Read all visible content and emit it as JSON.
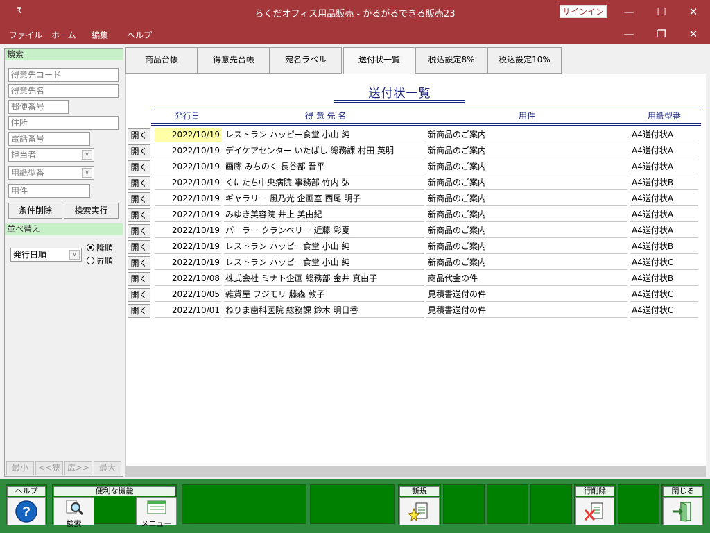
{
  "window": {
    "title": "らくだオフィス用品販売 - かるがるできる販売23",
    "signin": "サインイン",
    "quick_access": "₹"
  },
  "menu": [
    "ファイル",
    "ホーム",
    "編集",
    "ヘルプ"
  ],
  "sidebar": {
    "search_header": "検索",
    "fields": {
      "customer_code": "得意先コード",
      "customer_name": "得意先名",
      "postal": "郵便番号",
      "address": "住所",
      "phone": "電話番号",
      "staff": "担当者",
      "paper_type": "用紙型番",
      "subject": "用件"
    },
    "clear_button": "条件削除",
    "search_button": "検索実行",
    "sort_header": "並べ替え",
    "sort_field": "発行日順",
    "sort_desc": "降順",
    "sort_asc": "昇順",
    "zoom": [
      "最小",
      "<<狭",
      "広>>",
      "最大"
    ]
  },
  "tabs": [
    "商品台帳",
    "得意先台帳",
    "宛名ラベル",
    "送付状一覧",
    "税込設定8%",
    "税込設定10%"
  ],
  "list": {
    "title": "送付状一覧",
    "columns": {
      "date": "発行日",
      "customer": "得 意 先 名",
      "subject": "用件",
      "paper": "用紙型番"
    },
    "open_label": "開く",
    "rows": [
      {
        "date": "2022/10/19",
        "customer": "レストラン ハッピー食堂 小山 純",
        "subject": "新商品のご案内",
        "paper": "A4送付状A"
      },
      {
        "date": "2022/10/19",
        "customer": "デイケアセンター いたばし 総務課 村田 英明",
        "subject": "新商品のご案内",
        "paper": "A4送付状A"
      },
      {
        "date": "2022/10/19",
        "customer": "画廊 みちのく 長谷部 晋平",
        "subject": "新商品のご案内",
        "paper": "A4送付状A"
      },
      {
        "date": "2022/10/19",
        "customer": "くにたち中央病院 事務部 竹内 弘",
        "subject": "新商品のご案内",
        "paper": "A4送付状B"
      },
      {
        "date": "2022/10/19",
        "customer": "ギャラリー 風乃光 企画室 西尾 明子",
        "subject": "新商品のご案内",
        "paper": "A4送付状A"
      },
      {
        "date": "2022/10/19",
        "customer": "みゆき美容院 井上 美由紀",
        "subject": "新商品のご案内",
        "paper": "A4送付状A"
      },
      {
        "date": "2022/10/19",
        "customer": "パーラー クランベリー 近藤 彩夏",
        "subject": "新商品のご案内",
        "paper": "A4送付状A"
      },
      {
        "date": "2022/10/19",
        "customer": "レストラン ハッピー食堂 小山 純",
        "subject": "新商品のご案内",
        "paper": "A4送付状B"
      },
      {
        "date": "2022/10/19",
        "customer": "レストラン ハッピー食堂 小山 純",
        "subject": "新商品のご案内",
        "paper": "A4送付状C"
      },
      {
        "date": "2022/10/08",
        "customer": "株式会社 ミナト企画 総務部 金井 真由子",
        "subject": "商品代金の件",
        "paper": "A4送付状B"
      },
      {
        "date": "2022/10/05",
        "customer": "雑貨屋 フジモリ 藤森 敦子",
        "subject": "見積書送付の件",
        "paper": "A4送付状C"
      },
      {
        "date": "2022/10/01",
        "customer": "ねりま歯科医院 総務課 鈴木 明日香",
        "subject": "見積書送付の件",
        "paper": "A4送付状C"
      }
    ]
  },
  "footer": {
    "help": "ヘルプ",
    "tools": "便利な機能",
    "search": "検索",
    "menu": "メニュー",
    "new": "新規",
    "delete_row": "行削除",
    "close": "閉じる"
  },
  "colors": {
    "title_bar": "#a4373a",
    "footer": "#008000",
    "sidebar_header": "#c8f0c8",
    "heading": "#1a237e",
    "selected_cell": "#ffffa8"
  }
}
